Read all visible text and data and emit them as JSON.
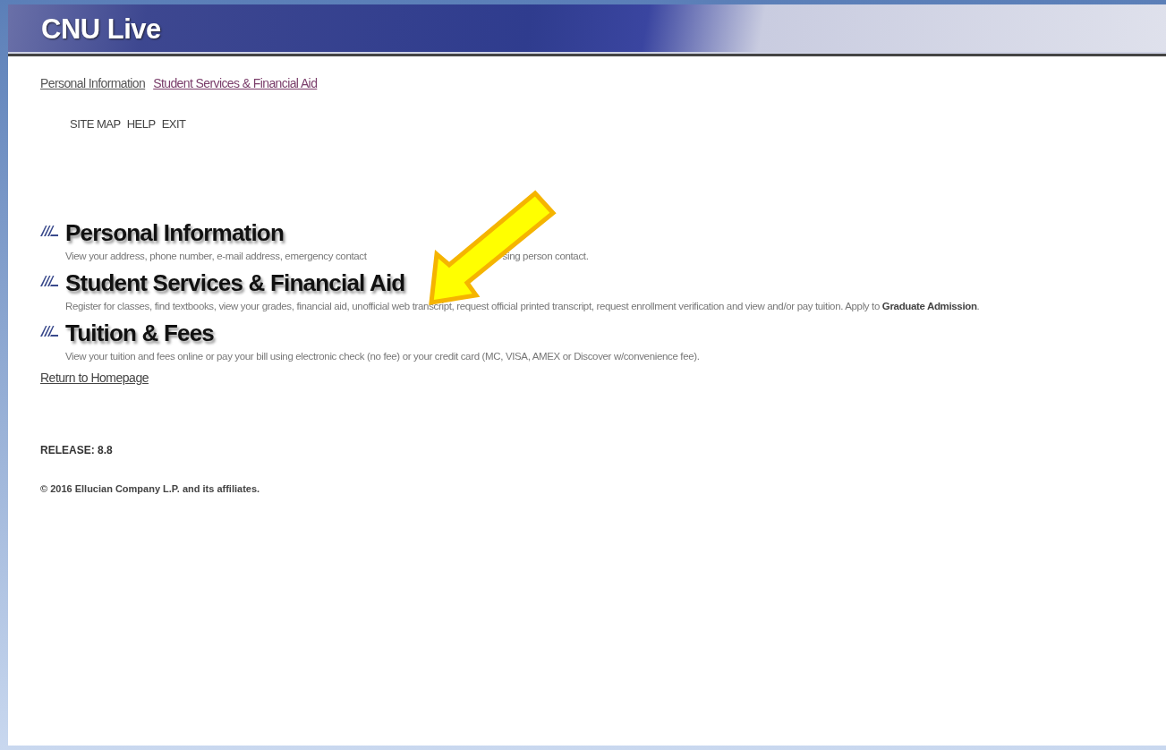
{
  "header": {
    "title": "CNU Live"
  },
  "nav_links": [
    {
      "label": "Personal Information",
      "visited": false
    },
    {
      "label": "Student Services & Financial Aid",
      "visited": true
    }
  ],
  "utility_links": [
    "SITE MAP",
    "HELP",
    "EXIT"
  ],
  "menu": [
    {
      "title": "Personal Information",
      "description": [
        "View your address, phone number, e-mail address, emergency contact",
        "sing person contact."
      ]
    },
    {
      "title": "Student Services & Financial Aid",
      "description": [
        "Register for classes, find textbooks, view your grades, financial aid, unofficial web transcript, request official printed transcript, request enrollment verification and view and/or pay tuition. Apply to **Graduate Admission**."
      ]
    },
    {
      "title": "Tuition & Fees",
      "description": [
        "View your tuition and fees online or pay your bill using electronic check (no fee) or your credit card (MC, VISA, AMEX or Discover w/convenience fee)."
      ]
    }
  ],
  "return_link": "Return to Homepage",
  "release": "RELEASE: 8.8",
  "copyright": "© 2016 Ellucian Company L.P. and its affiliates."
}
